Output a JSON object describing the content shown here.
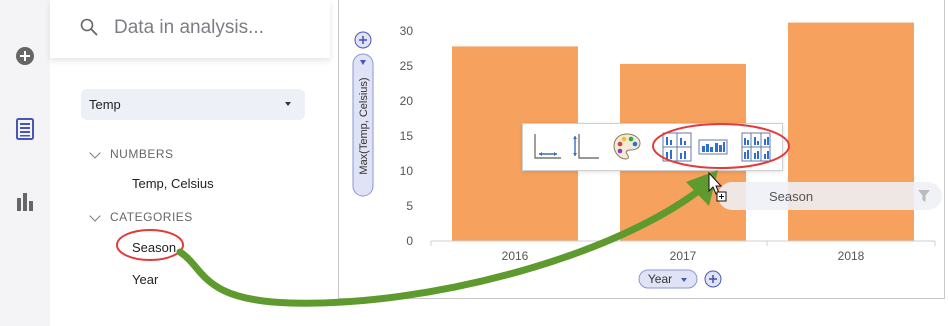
{
  "rail": {
    "icons": [
      "add-circle-icon",
      "data-table-icon",
      "visualizations-icon"
    ]
  },
  "panel": {
    "search_placeholder": "Data in analysis...",
    "table_dropdown": "Temp",
    "numbers_header": "NUMBERS",
    "numbers_fields": [
      "Temp, Celsius"
    ],
    "categories_header": "CATEGORIES",
    "category_fields": [
      "Season",
      "Year"
    ]
  },
  "chart": {
    "y_axis_selector": "Max(Temp, Celsius)",
    "x_axis_selector": "Year",
    "drop_target_label": "Season"
  },
  "toolbar": {
    "buttons": [
      "x-axis-icon",
      "y-axis-icon",
      "color-palette-icon",
      "trellis-columns-icon",
      "trellis-rows-icon",
      "trellis-panels-icon"
    ]
  },
  "colors": {
    "bar": "#f7a15e",
    "accent": "#4a55b8",
    "highlight": "#e23b3b",
    "arrow": "#5e9a2e"
  },
  "chart_data": {
    "type": "bar",
    "categories": [
      "2016",
      "2017",
      "2018"
    ],
    "values": [
      27.8,
      25.3,
      31.2
    ],
    "ylabel": "Max(Temp, Celsius)",
    "xlabel": "Year",
    "ylim": [
      0,
      33
    ],
    "yticks": [
      0,
      5,
      10,
      15,
      20,
      25,
      30
    ]
  }
}
